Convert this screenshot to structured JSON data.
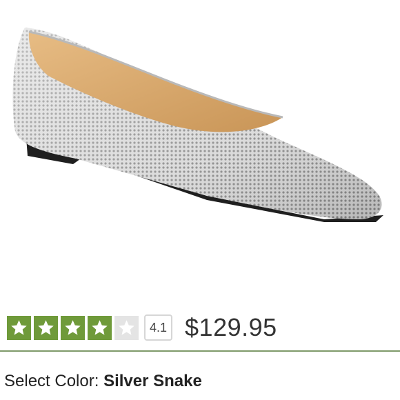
{
  "product": {
    "image_alt": "Silver Snake pointed-toe ballet flat",
    "price": "$129.95",
    "color_label": "Select Color: ",
    "color_value": "Silver Snake"
  },
  "rating": {
    "value": "4.1",
    "stars_filled": 4,
    "stars_total": 5,
    "star_color": "#6f9a3a",
    "empty_star_color": "#e4e4e4"
  },
  "colors": {
    "divider": "#7f9a6a",
    "insole": "#d9ab6e"
  }
}
